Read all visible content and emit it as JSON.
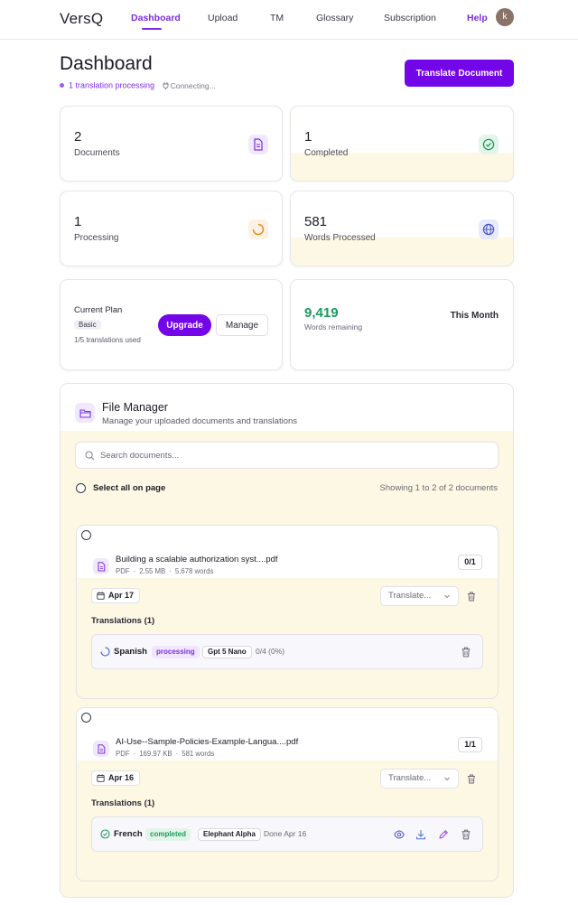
{
  "nav": {
    "logo": "VersQ",
    "links": [
      "Dashboard",
      "Upload",
      "TM",
      "Glossary",
      "Subscription"
    ],
    "help": "Help",
    "avatar_initial": "k"
  },
  "header": {
    "title": "Dashboard",
    "processing": "1 translation processing",
    "connection": "Connecting...",
    "translate_button": "Translate Document"
  },
  "stats": [
    {
      "value": "2",
      "label": "Documents",
      "icon": "document-icon"
    },
    {
      "value": "1",
      "label": "Completed",
      "icon": "check-circle-icon"
    },
    {
      "value": "1",
      "label": "Processing",
      "icon": "spinner-icon"
    },
    {
      "value": "581",
      "label": "Words Processed",
      "icon": "globe-icon"
    }
  ],
  "plan": {
    "label": "Current Plan",
    "tier": "Basic",
    "usage": "1/5 translations used",
    "upgrade": "Upgrade",
    "manage": "Manage"
  },
  "words": {
    "remaining": "9,419",
    "remaining_label": "Words remaining",
    "period": "This Month"
  },
  "file_manager": {
    "title": "File Manager",
    "subtitle": "Manage your uploaded documents and translations",
    "search_placeholder": "Search documents...",
    "select_all": "Select all on page",
    "showing": "Showing 1 to 2 of 2 documents",
    "documents": [
      {
        "name": "Building a scalable authorization syst....pdf",
        "type": "PDF",
        "size": "2.55 MB",
        "words": "5,678 words",
        "count": "0/1",
        "date": "Apr 17",
        "select_placeholder": "Translate...",
        "translations_label": "Translations (1)",
        "translation": {
          "language": "Spanish",
          "status": "processing",
          "model": "Gpt 5 Nano",
          "progress": "0/4 (0%)"
        }
      },
      {
        "name": "AI-Use--Sample-Policies-Example-Langua....pdf",
        "type": "PDF",
        "size": "169.97 KB",
        "words": "581 words",
        "count": "1/1",
        "date": "Apr 16",
        "select_placeholder": "Translate...",
        "translations_label": "Translations (1)",
        "translation": {
          "language": "French",
          "status": "completed",
          "model": "Elephant Alpha",
          "progress": "Done Apr 16"
        }
      }
    ]
  },
  "colors": {
    "accent": "#7306e8",
    "accent_text": "#7b2ee6",
    "success": "#1a9c5b",
    "cream": "#fdf8e3"
  }
}
